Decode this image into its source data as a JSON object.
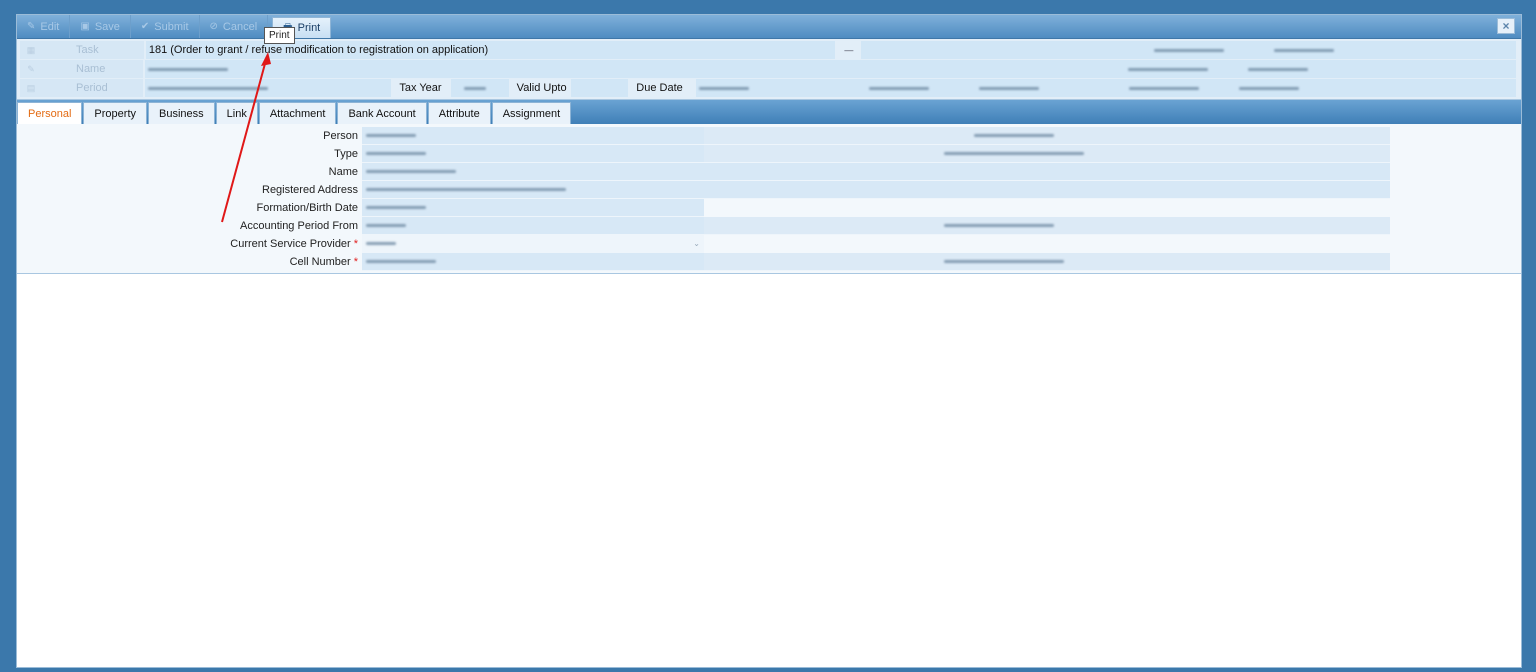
{
  "toolbar": {
    "edit_label": "Edit",
    "save_label": "Save",
    "submit_label": "Submit",
    "cancel_label": "Cancel",
    "print_label": "Print",
    "close_label": "×"
  },
  "tooltip": {
    "text": "Print"
  },
  "header": {
    "task_label": "Task",
    "task_value": "181 (Order to grant / refuse modification to registration on application)",
    "name_label": "Name",
    "period_label": "Period",
    "tax_year_label": "Tax Year",
    "valid_upto_label": "Valid Upto",
    "due_date_label": "Due Date"
  },
  "tabs": [
    {
      "label": "Personal",
      "active": true
    },
    {
      "label": "Property"
    },
    {
      "label": "Business"
    },
    {
      "label": "Link"
    },
    {
      "label": "Attachment"
    },
    {
      "label": "Bank Account"
    },
    {
      "label": "Attribute"
    },
    {
      "label": "Assignment"
    }
  ],
  "personal": {
    "person_label": "Person",
    "type_label": "Type",
    "name_label": "Name",
    "registered_address_label": "Registered Address",
    "formation_birth_date_label": "Formation/Birth Date",
    "accounting_period_from_label": "Accounting Period From",
    "current_service_provider_label": "Current Service Provider",
    "cell_number_label": "Cell Number",
    "required_mark": "*"
  },
  "colors": {
    "background": "#3b78ab",
    "toolbar": "#4f8cc1",
    "active_tab_text": "#e36b13",
    "required": "#e02020",
    "annotation_arrow": "#e01818"
  }
}
